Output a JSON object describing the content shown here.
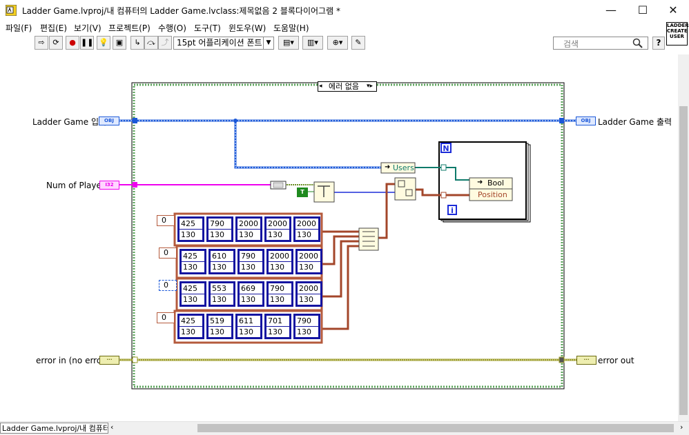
{
  "window": {
    "title": "Ladder Game.lvproj/내 컴퓨터의 Ladder Game.lvclass:제목없음 2 블록다이어그램 *",
    "minimize": "—",
    "maximize": "☐",
    "close": "✕"
  },
  "menu": {
    "items": [
      "파일(F)",
      "편집(E)",
      "보기(V)",
      "프로젝트(P)",
      "수행(O)",
      "도구(T)",
      "윈도우(W)",
      "도움말(H)"
    ]
  },
  "toolbar": {
    "font_value": "15pt 어플리케이션 폰트",
    "search_placeholder": "검색",
    "help_label": "?",
    "conn_pane_label": "LADDER CREATE USER"
  },
  "diagram": {
    "case_selector": "에러 없음",
    "labels": {
      "ladder_in": "Ladder Game 입력",
      "num_players": "Num of Player",
      "error_in": "error in (no error)",
      "ladder_out": "Ladder Game 출력",
      "error_out": "error out"
    },
    "unbundle_field": "Users",
    "loop_count": "N",
    "loop_index": "i",
    "element_fields": [
      "Bool",
      "Position"
    ],
    "terminal_tags": {
      "obj": "OBJ",
      "i32": "I32",
      "err": "···"
    },
    "bool_const": "T",
    "arrays": [
      {
        "index": "0",
        "x": [
          "425",
          "790",
          "2000",
          "2000",
          "2000"
        ],
        "y": [
          "130",
          "130",
          "130",
          "130",
          "130"
        ]
      },
      {
        "index": "0",
        "x": [
          "425",
          "610",
          "790",
          "2000",
          "2000"
        ],
        "y": [
          "130",
          "130",
          "130",
          "130",
          "130"
        ]
      },
      {
        "index": "0",
        "x": [
          "425",
          "553",
          "669",
          "790",
          "2000"
        ],
        "y": [
          "130",
          "130",
          "130",
          "130",
          "130"
        ]
      },
      {
        "index": "0",
        "x": [
          "425",
          "519",
          "611",
          "701",
          "790"
        ],
        "y": [
          "130",
          "130",
          "130",
          "130",
          "130"
        ]
      }
    ]
  },
  "status": {
    "path": "Ladder Game.lvproj/내 컴퓨터"
  },
  "colors": {
    "case_border": "#5aa35a",
    "object_wire": "#1b58d8",
    "i32_wire": "#ee00ee",
    "cluster_wire": "#a3462a",
    "error_wire": "#9c9c2a",
    "users_wire": "#0d7a6a",
    "loop_border": "#000000",
    "array_frame": "#b45a3c",
    "cell_border": "#1414a0"
  }
}
